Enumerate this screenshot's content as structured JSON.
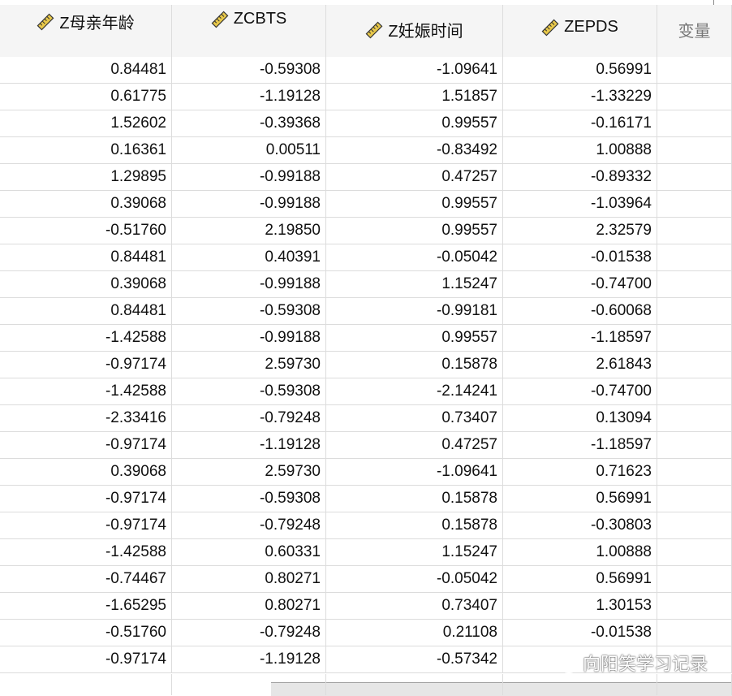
{
  "columns": [
    {
      "name": "Z母亲年龄",
      "icon": "ruler-icon"
    },
    {
      "name": "ZCBTS",
      "icon": "ruler-icon"
    },
    {
      "name": "Z妊娠时间",
      "icon": "ruler-icon"
    },
    {
      "name": "ZEPDS",
      "icon": "ruler-icon"
    },
    {
      "name": "变量",
      "icon": ""
    }
  ],
  "rows": [
    [
      "0.84481",
      "-0.59308",
      "-1.09641",
      "0.56991"
    ],
    [
      "0.61775",
      "-1.19128",
      "1.51857",
      "-1.33229"
    ],
    [
      "1.52602",
      "-0.39368",
      "0.99557",
      "-0.16171"
    ],
    [
      "0.16361",
      "0.00511",
      "-0.83492",
      "1.00888"
    ],
    [
      "1.29895",
      "-0.99188",
      "0.47257",
      "-0.89332"
    ],
    [
      "0.39068",
      "-0.99188",
      "0.99557",
      "-1.03964"
    ],
    [
      "-0.51760",
      "2.19850",
      "0.99557",
      "2.32579"
    ],
    [
      "0.84481",
      "0.40391",
      "-0.05042",
      "-0.01538"
    ],
    [
      "0.39068",
      "-0.99188",
      "1.15247",
      "-0.74700"
    ],
    [
      "0.84481",
      "-0.59308",
      "-0.99181",
      "-0.60068"
    ],
    [
      "-1.42588",
      "-0.99188",
      "0.99557",
      "-1.18597"
    ],
    [
      "-0.97174",
      "2.59730",
      "0.15878",
      "2.61843"
    ],
    [
      "-1.42588",
      "-0.59308",
      "-2.14241",
      "-0.74700"
    ],
    [
      "-2.33416",
      "-0.79248",
      "0.73407",
      "0.13094"
    ],
    [
      "-0.97174",
      "-1.19128",
      "0.47257",
      "-1.18597"
    ],
    [
      "0.39068",
      "2.59730",
      "-1.09641",
      "0.71623"
    ],
    [
      "-0.97174",
      "-0.59308",
      "0.15878",
      "0.56991"
    ],
    [
      "-0.97174",
      "-0.79248",
      "0.15878",
      "-0.30803"
    ],
    [
      "-1.42588",
      "0.60331",
      "1.15247",
      "1.00888"
    ],
    [
      "-0.74467",
      "0.80271",
      "-0.05042",
      "0.56991"
    ],
    [
      "-1.65295",
      "0.80271",
      "0.73407",
      "1.30153"
    ],
    [
      "-0.51760",
      "-0.79248",
      "0.21108",
      "-0.01538"
    ],
    [
      "-0.97174",
      "-1.19128",
      "-0.57342",
      ""
    ]
  ],
  "watermark": {
    "text": "向阳笑学习记录",
    "icon": "wechat-icon"
  },
  "colors": {
    "header_bg": "#f5f5f5",
    "grid_line": "#dcdcdc",
    "ruler_fill": "#e8c84a"
  }
}
